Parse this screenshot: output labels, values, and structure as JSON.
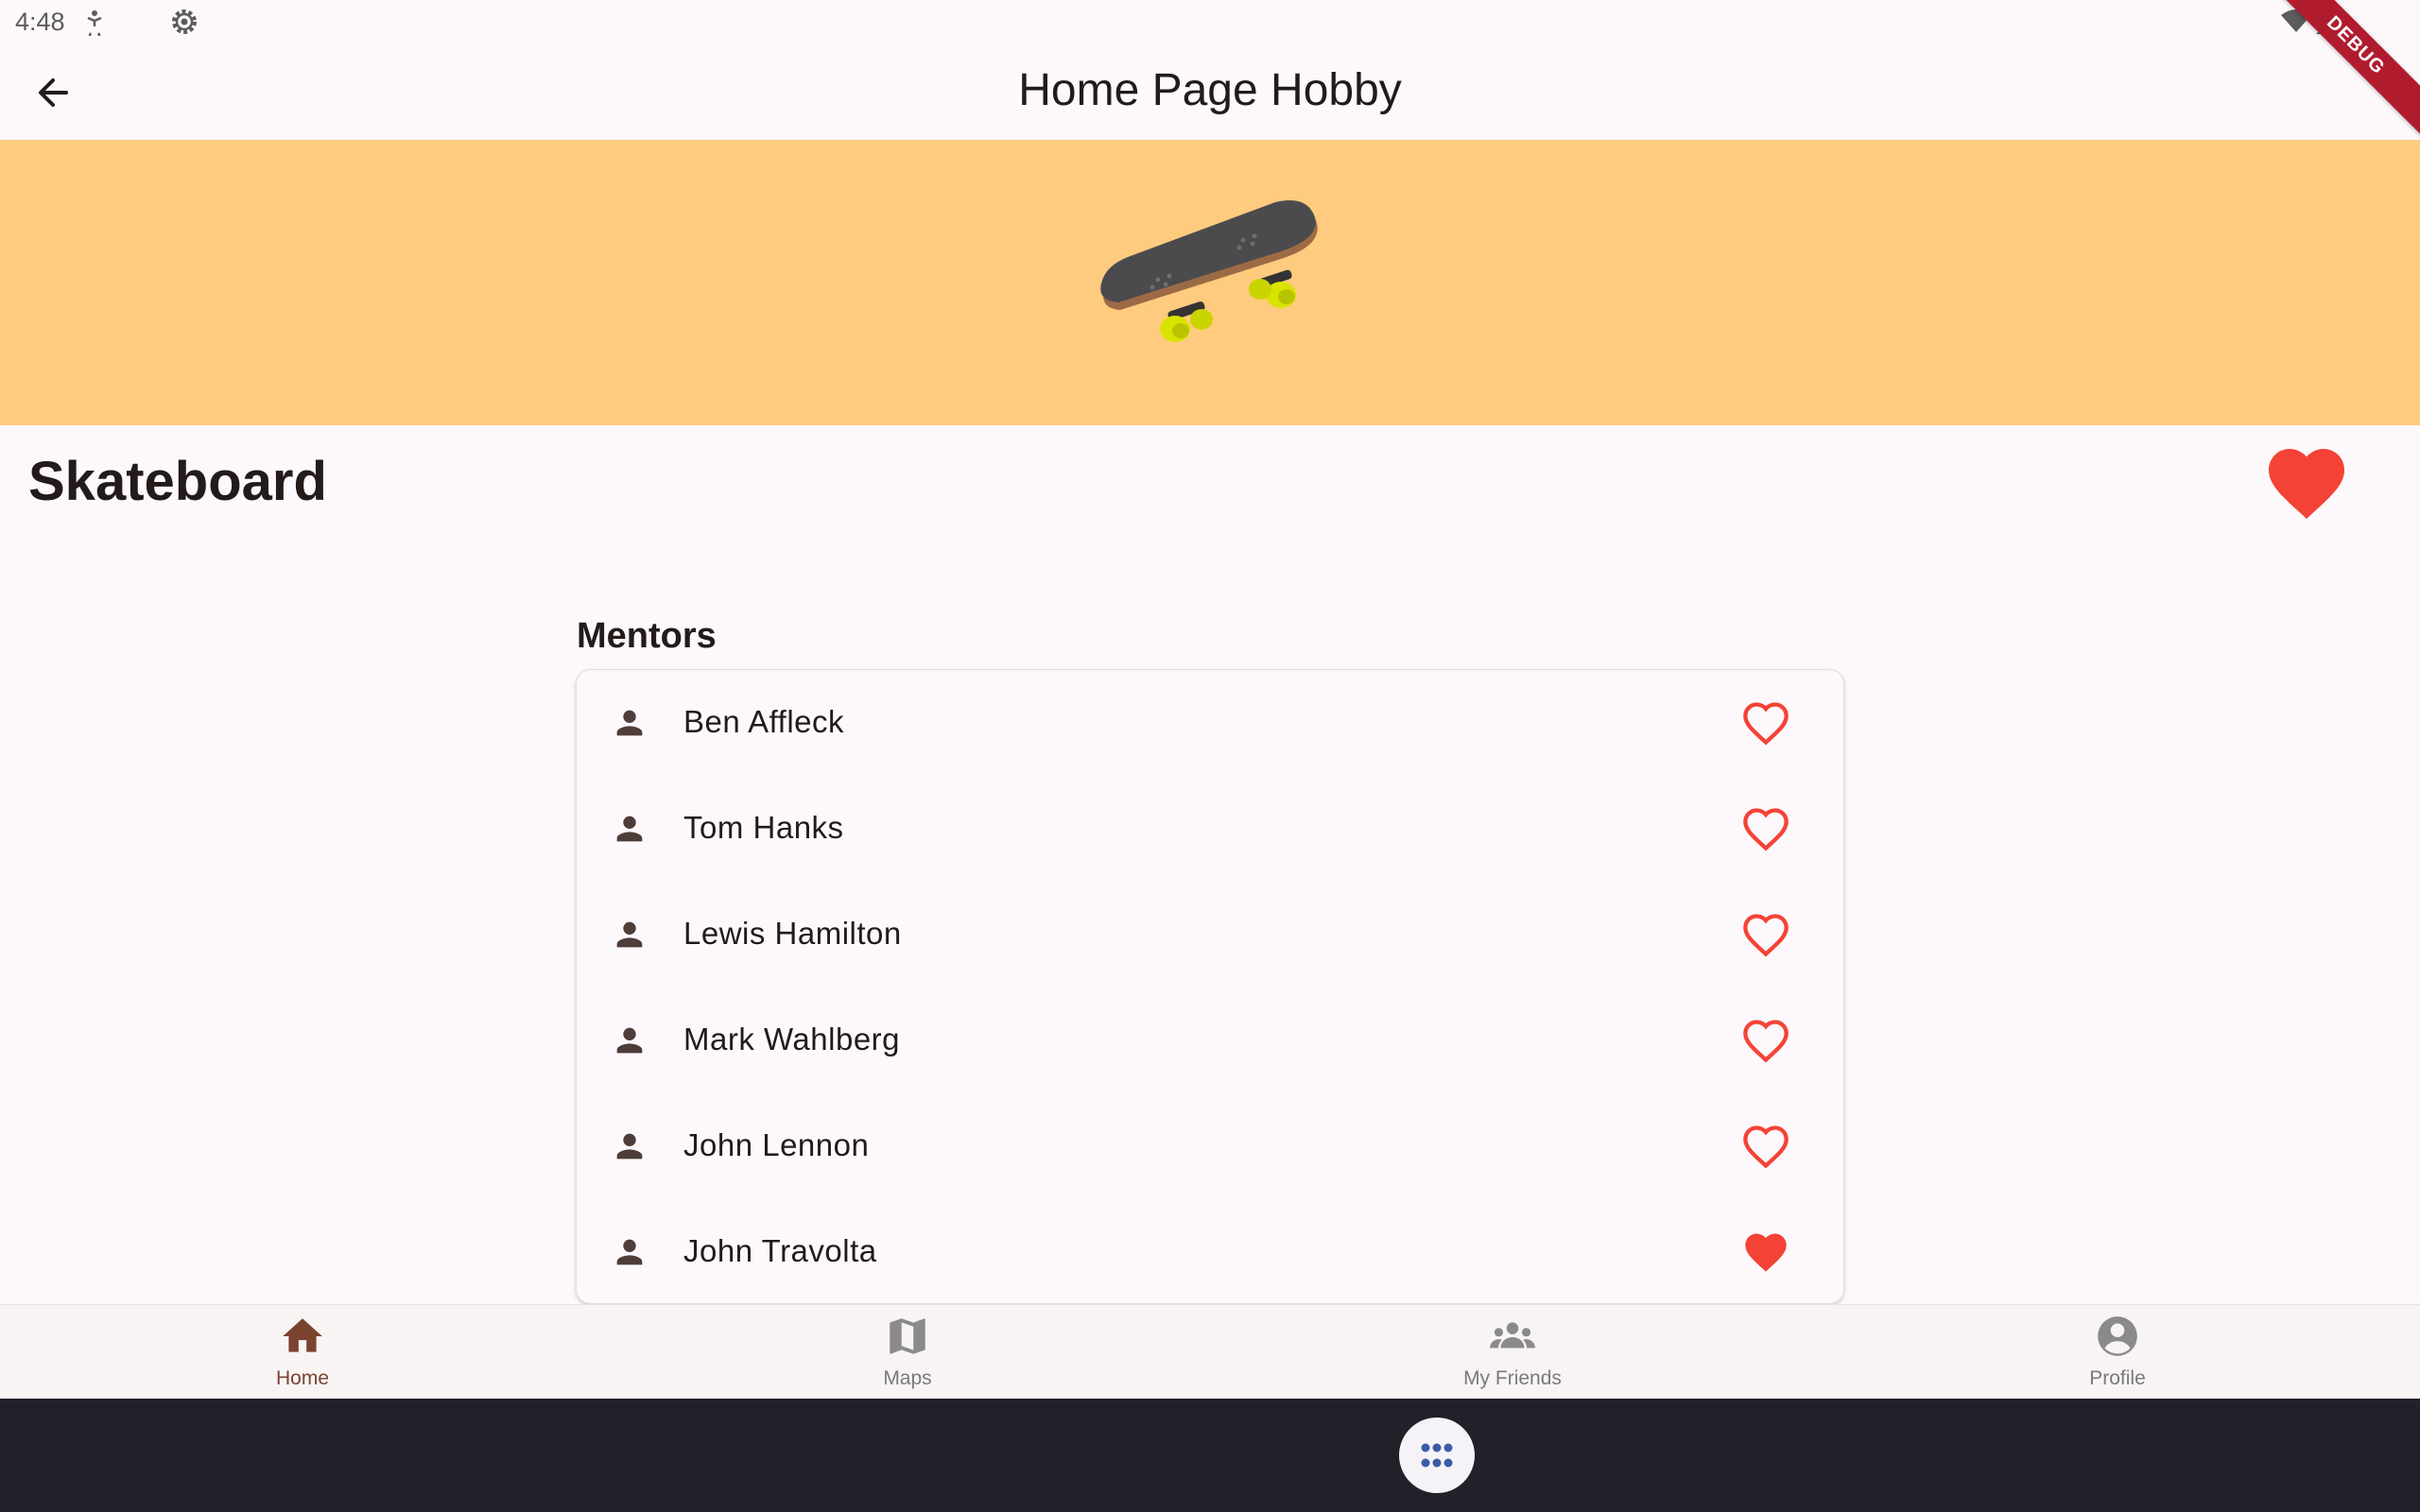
{
  "status_bar": {
    "time": "4:48",
    "icons": [
      "accessibility-icon",
      "settings-gear-icon",
      "wifi-icon",
      "cellular-signal-icon"
    ]
  },
  "debug_banner": "DEBUG",
  "app_bar": {
    "title": "Home Page Hobby",
    "back_icon": "arrow-back-icon"
  },
  "hero": {
    "image": "skateboard-image",
    "background": "#ffcb7f"
  },
  "hobby": {
    "name": "Skateboard",
    "favorited": true
  },
  "mentors": {
    "heading": "Mentors",
    "items": [
      {
        "name": "Ben Affleck",
        "favorited": false
      },
      {
        "name": "Tom Hanks",
        "favorited": false
      },
      {
        "name": "Lewis Hamilton",
        "favorited": false
      },
      {
        "name": "Mark Wahlberg",
        "favorited": false
      },
      {
        "name": "John Lennon",
        "favorited": false
      },
      {
        "name": "John Travolta",
        "favorited": true
      }
    ]
  },
  "bottom_nav": {
    "items": [
      {
        "label": "Home",
        "icon": "home-icon",
        "active": true
      },
      {
        "label": "Maps",
        "icon": "map-icon",
        "active": false
      },
      {
        "label": "My Friends",
        "icon": "group-icon",
        "active": false
      },
      {
        "label": "Profile",
        "icon": "account-circle-icon",
        "active": false
      }
    ]
  },
  "colors": {
    "accent_red": "#f44336",
    "active_nav": "#7a4330",
    "inactive_nav": "#8a8a8a",
    "system_bar": "#22212a"
  }
}
